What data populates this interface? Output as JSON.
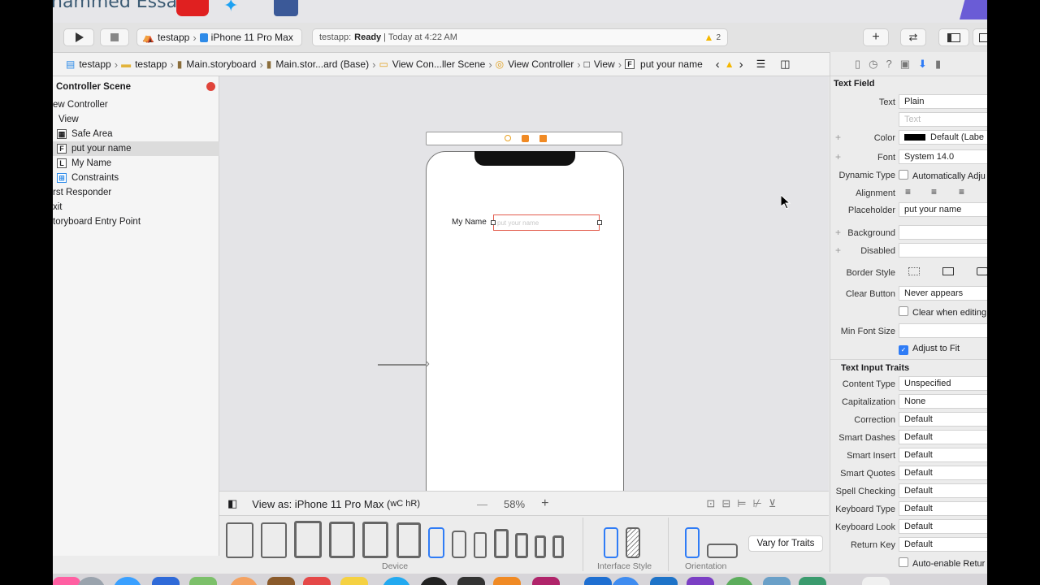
{
  "banner": {
    "name": "hammed Essa"
  },
  "toolbar": {
    "scheme_app": "testapp",
    "scheme_device": "iPhone 11 Pro Max",
    "status_app": "testapp:",
    "status_state": "Ready",
    "status_time": "| Today at 4:22 AM",
    "warning_count": "2"
  },
  "jumpbar": {
    "crumbs": [
      "testapp",
      "testapp",
      "Main.storyboard",
      "Main.stor...ard (Base)",
      "View Con...ller Scene",
      "View Controller",
      "View",
      "put your name"
    ]
  },
  "navigator": {
    "scene_title": "Controller Scene",
    "items": [
      "ew Controller",
      "View",
      "Safe Area",
      "put your name",
      "My Name",
      "Constraints",
      "rst Responder",
      "xit",
      "toryboard Entry Point"
    ],
    "item_badges": [
      "",
      "",
      "",
      "F",
      "L",
      "",
      "",
      "",
      ""
    ]
  },
  "canvas": {
    "label_text": "My Name",
    "field_placeholder": "put your name"
  },
  "viewas": {
    "device": "View as: iPhone 11 Pro Max (",
    "size_class": "wC hR)",
    "zoom": "58%"
  },
  "devices": {
    "device_label": "Device",
    "interface_label": "Interface Style",
    "orientation_label": "Orientation",
    "vary_button": "Vary for Traits"
  },
  "inspector": {
    "section_title": "Text Field",
    "text_label": "Text",
    "text_value": "Plain",
    "text_placeholder": "Text",
    "color_label": "Color",
    "color_value": "Default (Labe",
    "font_label": "Font",
    "font_value": "System 14.0",
    "dynamic_label": "Dynamic Type",
    "dynamic_value": "Automatically Adju",
    "alignment_label": "Alignment",
    "placeholder_label": "Placeholder",
    "placeholder_value": "put your name",
    "background_label": "Background",
    "disabled_label": "Disabled",
    "border_label": "Border Style",
    "clear_label": "Clear Button",
    "clear_value": "Never appears",
    "clear_editing": "Clear when editing",
    "minfont_label": "Min Font Size",
    "adjust_label": "Adjust to Fit",
    "traits_title": "Text Input Traits",
    "rows": [
      {
        "label": "Content Type",
        "value": "Unspecified"
      },
      {
        "label": "Capitalization",
        "value": "None"
      },
      {
        "label": "Correction",
        "value": "Default"
      },
      {
        "label": "Smart Dashes",
        "value": "Default"
      },
      {
        "label": "Smart Insert",
        "value": "Default"
      },
      {
        "label": "Smart Quotes",
        "value": "Default"
      },
      {
        "label": "Spell Checking",
        "value": "Default"
      },
      {
        "label": "Keyboard Type",
        "value": "Default"
      },
      {
        "label": "Keyboard Look",
        "value": "Default"
      },
      {
        "label": "Return Key",
        "value": "Default"
      }
    ],
    "auto_enable": "Auto-enable Retur"
  },
  "colors": {
    "accent": "#2f7cf6",
    "warning": "#f5b700",
    "selection": "#e25b4c"
  }
}
